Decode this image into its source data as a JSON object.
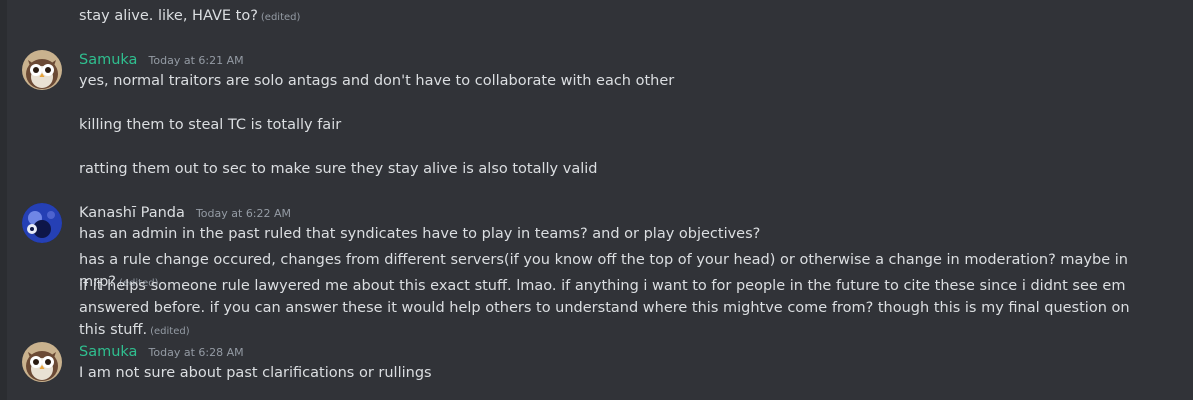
{
  "colors": {
    "background": "#313338",
    "samuka_name": "#2fbf8f",
    "kanashi_name": "#dbdee1",
    "text": "#dbdee1",
    "muted": "#949ba4"
  },
  "previous_message": {
    "text": "stay alive. like, HAVE to?",
    "edited": "(edited)"
  },
  "messages": [
    {
      "user": "Samuka",
      "avatar": "owl-avatar",
      "timestamp": "Today at 6:21 AM",
      "lines": [
        "yes, normal traitors are solo antags and don't have to collaborate with each other",
        "killing them to steal TC is totally fair",
        "ratting them out to sec to make sure they stay alive is also totally valid"
      ]
    },
    {
      "user": "Kanashī Panda",
      "avatar": "panda-avatar",
      "timestamp": "Today at 6:22 AM",
      "lines": [
        "has an admin in the past ruled that syndicates have to play in teams? and or play objectives?",
        "has a rule change occured, changes from different servers(if you know off the top of your head) or otherwise a change in moderation? maybe in mrp?",
        "if it helps someone rule lawyered me about this exact stuff. lmao. if anything i want to for people in the future to cite these since i didnt see em answered before. if you can answer these it would help others to understand where this mightve come from? though this is my final question on this stuff."
      ],
      "edited": "(edited)"
    },
    {
      "user": "Samuka",
      "avatar": "owl-avatar",
      "timestamp": "Today at 6:28 AM",
      "lines": [
        "I am not sure about past clarifications or rullings"
      ]
    }
  ]
}
